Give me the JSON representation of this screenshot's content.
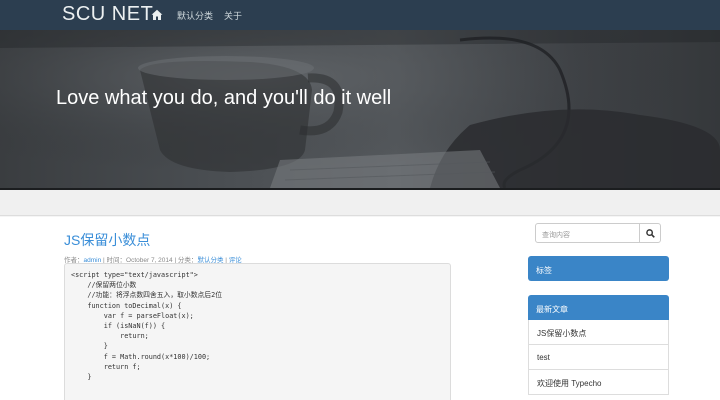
{
  "navbar": {
    "brand": "SCU NET",
    "home_icon": "home-icon",
    "links": [
      "默认分类",
      "关于"
    ]
  },
  "hero": {
    "title": "Love what you do, and you'll do it well"
  },
  "post": {
    "title": "JS保留小数点",
    "meta": {
      "author_label": "作者：",
      "author": "admin",
      "time_label": " | 时间：October 7, 2014 | 分类：",
      "category": "默认分类",
      "sep": " | ",
      "comments": "评论"
    },
    "code_lines": [
      "<script type=\"text/javascript\">",
      "    //保留两位小数",
      "    //功能：将浮点数四舍五入，取小数点后2位",
      "    function toDecimal(x) {",
      "        var f = parseFloat(x);",
      "        if (isNaN(f)) {",
      "            return;",
      "        }",
      "        f = Math.round(x*100)/100;",
      "        return f;",
      "    }"
    ]
  },
  "sidebar": {
    "search_placeholder": "查询内容",
    "search_icon": "search-icon",
    "tags_heading": "标签",
    "recent_heading": "最新文章",
    "recent_posts": [
      "JS保留小数点",
      "test",
      "欢迎使用 Typecho"
    ]
  },
  "colors": {
    "navbar": "#2c3e50",
    "accent": "#3a85c7",
    "link": "#3a8ed8"
  }
}
